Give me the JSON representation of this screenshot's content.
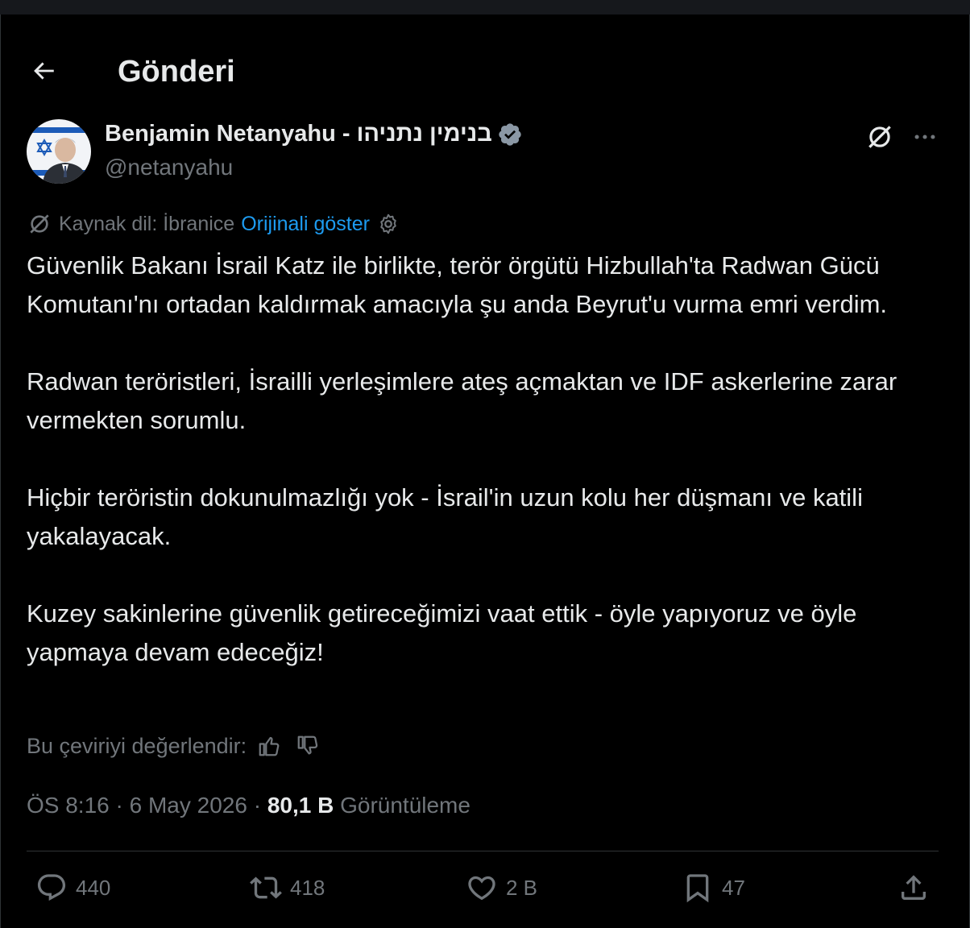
{
  "header": {
    "back_icon": "arrow-left-icon",
    "title": "Gönderi"
  },
  "author": {
    "name": "Benjamin Netanyahu - בנימין נתניהו",
    "handle": "@netanyahu",
    "verified_color": "#8b98a5"
  },
  "translation": {
    "source_label": "Kaynak dil: İbranice",
    "show_original_label": "Orijinali göster",
    "rate_label": "Bu çeviriyi değerlendir:"
  },
  "tweet": {
    "paragraphs": [
      "Güvenlik Bakanı İsrail Katz ile birlikte, terör örgütü Hizbullah'ta Radwan Gücü Komutanı'nı ortadan kaldırmak amacıyla şu anda Beyrut'u vurma emri verdim.",
      "Radwan teröristleri, İsrailli yerleşimlere ateş açmaktan ve IDF askerlerine zarar vermekten sorumlu.",
      "Hiçbir teröristin dokunulmazlığı yok - İsrail'in uzun kolu her düşmanı ve katili yakalayacak.",
      "Kuzey sakinlerine güvenlik getireceğimizi vaat ettik - öyle yapıyoruz ve öyle yapmaya devam edeceğiz!"
    ],
    "timestamp": "ÖS 8:16 · 6 May 2026 · ",
    "views_count": "80,1 B",
    "views_label": " Görüntüleme"
  },
  "actions": {
    "replies": "440",
    "reposts": "418",
    "likes": "2 B",
    "bookmarks": "47"
  },
  "colors": {
    "background": "#000000",
    "text": "#e7e9ea",
    "muted": "#71767b",
    "accent": "#1d9bf0",
    "divider": "#2f3336"
  }
}
